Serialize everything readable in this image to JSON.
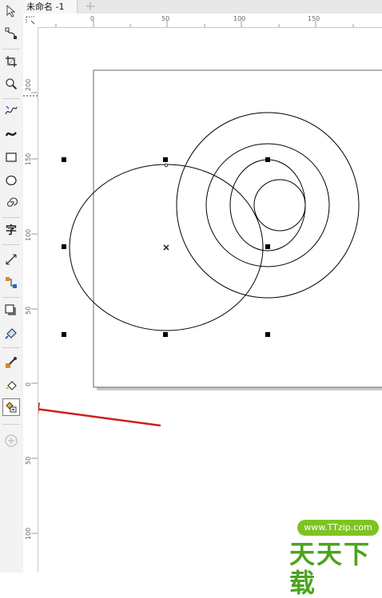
{
  "document": {
    "tab_title": "未命名 -1",
    "add_tab_symbol": "+"
  },
  "rulers": {
    "horizontal_ticks": [
      "0",
      "50",
      "100",
      "150"
    ],
    "vertical_ticks": [
      "200",
      "150",
      "100",
      "50",
      "0",
      "50",
      "100"
    ]
  },
  "toolbox": [
    {
      "id": "pick",
      "icon": "pick-arrow-icon"
    },
    {
      "id": "shape",
      "icon": "shape-edit-icon"
    },
    {
      "id": "crop",
      "icon": "crop-icon"
    },
    {
      "id": "zoom",
      "icon": "zoom-icon"
    },
    {
      "id": "freehand",
      "icon": "freehand-icon"
    },
    {
      "id": "artistic-media",
      "icon": "artistic-media-icon"
    },
    {
      "id": "rectangle",
      "icon": "rectangle-icon"
    },
    {
      "id": "ellipse",
      "icon": "ellipse-icon"
    },
    {
      "id": "spiral",
      "icon": "spiral-icon"
    },
    {
      "id": "text",
      "icon": "text-icon",
      "label": "字"
    },
    {
      "id": "dimension",
      "icon": "dimension-icon"
    },
    {
      "id": "connector",
      "icon": "connector-icon"
    },
    {
      "id": "drop-shadow",
      "icon": "drop-shadow-icon"
    },
    {
      "id": "transparency",
      "icon": "transparency-icon"
    },
    {
      "id": "eyedropper",
      "icon": "eyedropper-icon"
    },
    {
      "id": "interactive-fill",
      "icon": "interactive-fill-icon"
    },
    {
      "id": "smart-fill",
      "icon": "smart-fill-icon"
    },
    {
      "id": "add-tool",
      "icon": "add-circle-icon"
    }
  ],
  "colors": {
    "arrow": "#cc1f1f",
    "watermark_green": "#4aa51f",
    "watermark_badge": "#7fc323"
  },
  "watermark": {
    "url": "www.TTzip.com",
    "brand": "天天下载"
  }
}
